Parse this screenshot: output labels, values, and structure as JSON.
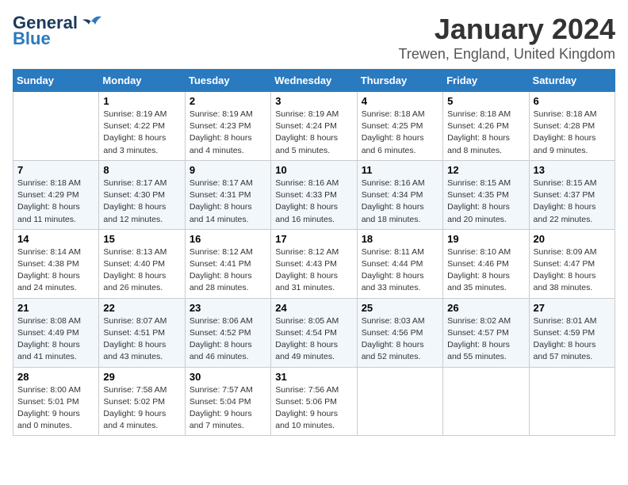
{
  "header": {
    "logo_general": "General",
    "logo_blue": "Blue",
    "title": "January 2024",
    "subtitle": "Trewen, England, United Kingdom"
  },
  "days_of_week": [
    "Sunday",
    "Monday",
    "Tuesday",
    "Wednesday",
    "Thursday",
    "Friday",
    "Saturday"
  ],
  "weeks": [
    [
      {
        "day": "",
        "info": ""
      },
      {
        "day": "1",
        "info": "Sunrise: 8:19 AM\nSunset: 4:22 PM\nDaylight: 8 hours\nand 3 minutes."
      },
      {
        "day": "2",
        "info": "Sunrise: 8:19 AM\nSunset: 4:23 PM\nDaylight: 8 hours\nand 4 minutes."
      },
      {
        "day": "3",
        "info": "Sunrise: 8:19 AM\nSunset: 4:24 PM\nDaylight: 8 hours\nand 5 minutes."
      },
      {
        "day": "4",
        "info": "Sunrise: 8:18 AM\nSunset: 4:25 PM\nDaylight: 8 hours\nand 6 minutes."
      },
      {
        "day": "5",
        "info": "Sunrise: 8:18 AM\nSunset: 4:26 PM\nDaylight: 8 hours\nand 8 minutes."
      },
      {
        "day": "6",
        "info": "Sunrise: 8:18 AM\nSunset: 4:28 PM\nDaylight: 8 hours\nand 9 minutes."
      }
    ],
    [
      {
        "day": "7",
        "info": "Sunrise: 8:18 AM\nSunset: 4:29 PM\nDaylight: 8 hours\nand 11 minutes."
      },
      {
        "day": "8",
        "info": "Sunrise: 8:17 AM\nSunset: 4:30 PM\nDaylight: 8 hours\nand 12 minutes."
      },
      {
        "day": "9",
        "info": "Sunrise: 8:17 AM\nSunset: 4:31 PM\nDaylight: 8 hours\nand 14 minutes."
      },
      {
        "day": "10",
        "info": "Sunrise: 8:16 AM\nSunset: 4:33 PM\nDaylight: 8 hours\nand 16 minutes."
      },
      {
        "day": "11",
        "info": "Sunrise: 8:16 AM\nSunset: 4:34 PM\nDaylight: 8 hours\nand 18 minutes."
      },
      {
        "day": "12",
        "info": "Sunrise: 8:15 AM\nSunset: 4:35 PM\nDaylight: 8 hours\nand 20 minutes."
      },
      {
        "day": "13",
        "info": "Sunrise: 8:15 AM\nSunset: 4:37 PM\nDaylight: 8 hours\nand 22 minutes."
      }
    ],
    [
      {
        "day": "14",
        "info": "Sunrise: 8:14 AM\nSunset: 4:38 PM\nDaylight: 8 hours\nand 24 minutes."
      },
      {
        "day": "15",
        "info": "Sunrise: 8:13 AM\nSunset: 4:40 PM\nDaylight: 8 hours\nand 26 minutes."
      },
      {
        "day": "16",
        "info": "Sunrise: 8:12 AM\nSunset: 4:41 PM\nDaylight: 8 hours\nand 28 minutes."
      },
      {
        "day": "17",
        "info": "Sunrise: 8:12 AM\nSunset: 4:43 PM\nDaylight: 8 hours\nand 31 minutes."
      },
      {
        "day": "18",
        "info": "Sunrise: 8:11 AM\nSunset: 4:44 PM\nDaylight: 8 hours\nand 33 minutes."
      },
      {
        "day": "19",
        "info": "Sunrise: 8:10 AM\nSunset: 4:46 PM\nDaylight: 8 hours\nand 35 minutes."
      },
      {
        "day": "20",
        "info": "Sunrise: 8:09 AM\nSunset: 4:47 PM\nDaylight: 8 hours\nand 38 minutes."
      }
    ],
    [
      {
        "day": "21",
        "info": "Sunrise: 8:08 AM\nSunset: 4:49 PM\nDaylight: 8 hours\nand 41 minutes."
      },
      {
        "day": "22",
        "info": "Sunrise: 8:07 AM\nSunset: 4:51 PM\nDaylight: 8 hours\nand 43 minutes."
      },
      {
        "day": "23",
        "info": "Sunrise: 8:06 AM\nSunset: 4:52 PM\nDaylight: 8 hours\nand 46 minutes."
      },
      {
        "day": "24",
        "info": "Sunrise: 8:05 AM\nSunset: 4:54 PM\nDaylight: 8 hours\nand 49 minutes."
      },
      {
        "day": "25",
        "info": "Sunrise: 8:03 AM\nSunset: 4:56 PM\nDaylight: 8 hours\nand 52 minutes."
      },
      {
        "day": "26",
        "info": "Sunrise: 8:02 AM\nSunset: 4:57 PM\nDaylight: 8 hours\nand 55 minutes."
      },
      {
        "day": "27",
        "info": "Sunrise: 8:01 AM\nSunset: 4:59 PM\nDaylight: 8 hours\nand 57 minutes."
      }
    ],
    [
      {
        "day": "28",
        "info": "Sunrise: 8:00 AM\nSunset: 5:01 PM\nDaylight: 9 hours\nand 0 minutes."
      },
      {
        "day": "29",
        "info": "Sunrise: 7:58 AM\nSunset: 5:02 PM\nDaylight: 9 hours\nand 4 minutes."
      },
      {
        "day": "30",
        "info": "Sunrise: 7:57 AM\nSunset: 5:04 PM\nDaylight: 9 hours\nand 7 minutes."
      },
      {
        "day": "31",
        "info": "Sunrise: 7:56 AM\nSunset: 5:06 PM\nDaylight: 9 hours\nand 10 minutes."
      },
      {
        "day": "",
        "info": ""
      },
      {
        "day": "",
        "info": ""
      },
      {
        "day": "",
        "info": ""
      }
    ]
  ]
}
